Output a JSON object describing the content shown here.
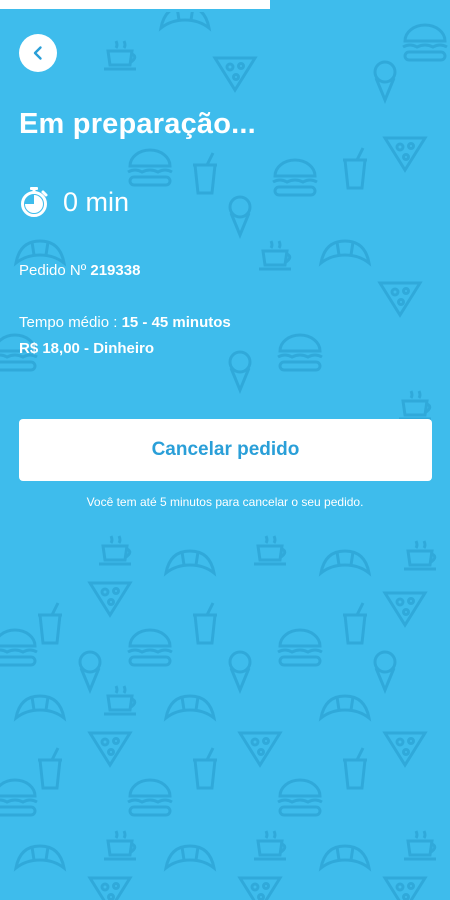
{
  "progress": {
    "fraction": 0.6
  },
  "header": {
    "back_icon": "chevron-left-icon"
  },
  "status": {
    "title": "Em preparação...",
    "timer_icon": "stopwatch-icon",
    "elapsed": "0 min"
  },
  "order": {
    "label": "Pedido Nº",
    "number": "219338"
  },
  "details": {
    "time_label": "Tempo médio :",
    "time_value": "15 - 45 minutos",
    "price_payment": "R$ 18,00 - Dinheiro"
  },
  "actions": {
    "cancel_label": "Cancelar pedido",
    "cancel_note": "Você tem até 5 minutos para cancelar o seu pedido."
  },
  "colors": {
    "background": "#3ebcec",
    "accent": "#2a9fd8",
    "pattern": "#35acdc"
  }
}
